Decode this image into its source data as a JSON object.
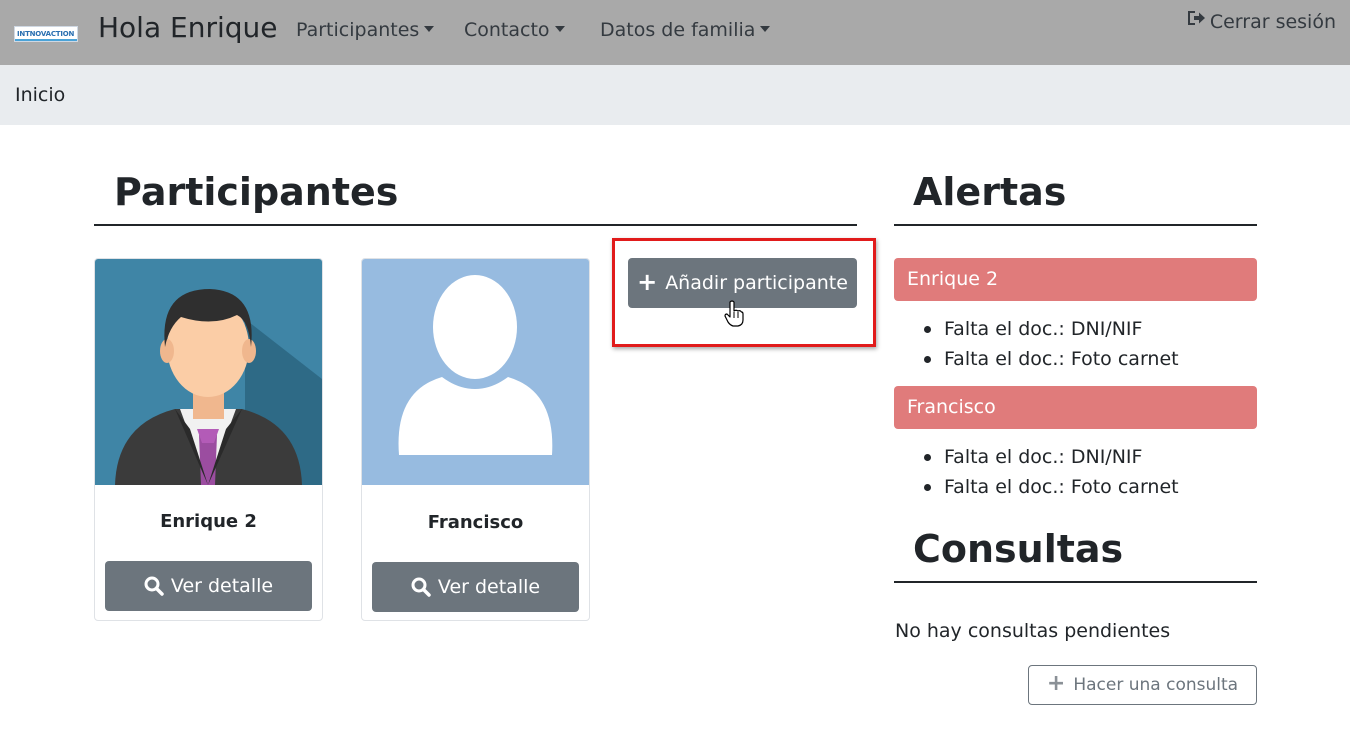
{
  "navbar": {
    "logo_text": "INTNOVACTION",
    "brand": "Hola Enrique",
    "items": [
      {
        "label": "Participantes"
      },
      {
        "label": "Contacto"
      },
      {
        "label": "Datos de familia"
      }
    ],
    "logout": "Cerrar sesión",
    "bg_color": "#a9a9a9"
  },
  "breadcrumb": {
    "current": "Inicio"
  },
  "participants": {
    "title": "Participantes",
    "cards": [
      {
        "name": "Enrique 2",
        "button": "Ver detalle",
        "avatar": "businessman-avatar"
      },
      {
        "name": "Francisco",
        "button": "Ver detalle",
        "avatar": "generic-user-silhouette"
      }
    ],
    "add_button": "Añadir participante"
  },
  "alerts": {
    "title": "Alertas",
    "color": "#e07b7b",
    "groups": [
      {
        "name": "Enrique 2",
        "items": [
          "Falta el doc.: DNI/NIF",
          "Falta el doc.: Foto carnet"
        ]
      },
      {
        "name": "Francisco",
        "items": [
          "Falta el doc.: DNI/NIF",
          "Falta el doc.: Foto carnet"
        ]
      }
    ]
  },
  "queries": {
    "title": "Consultas",
    "empty_text": "No hay consultas pendientes",
    "button": "Hacer una consulta"
  },
  "icons": {
    "plus": "plus-icon",
    "search": "search-icon",
    "logout": "sign-out-icon",
    "cursor": "hand-pointer-icon"
  }
}
